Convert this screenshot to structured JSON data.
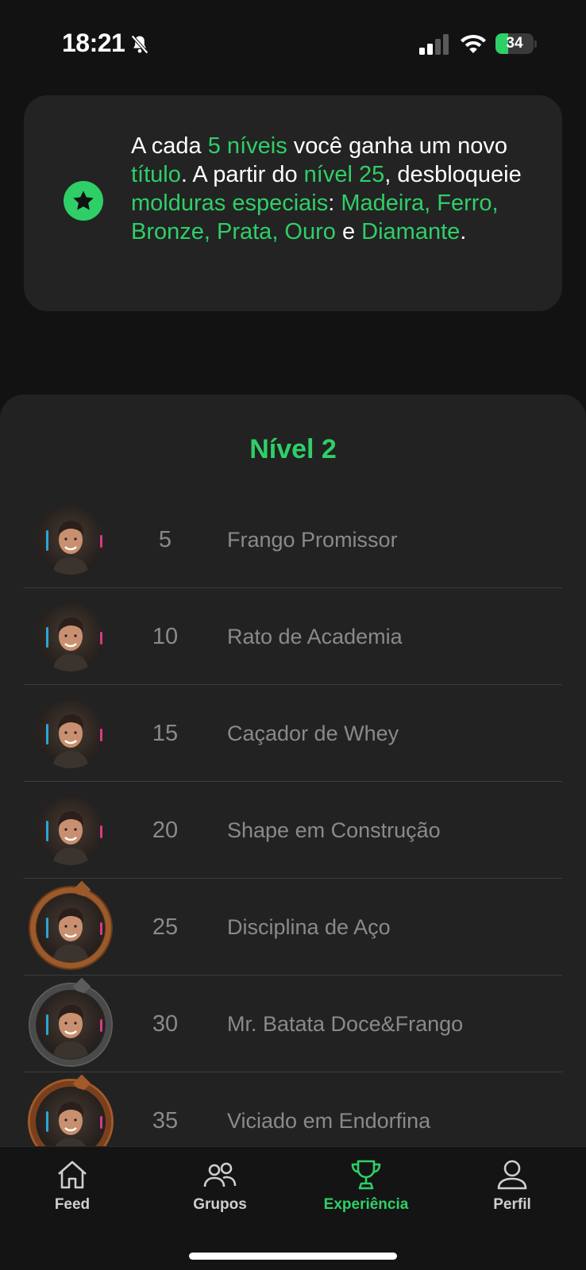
{
  "status_bar": {
    "time": "18:21",
    "battery_level": "34",
    "battery_fraction": 0.34,
    "icons": [
      "bell-slash-icon",
      "cellular-signal-icon",
      "wifi-icon",
      "battery-charging-icon"
    ]
  },
  "info_card": {
    "icon": "star-icon",
    "segments": [
      {
        "text": "A cada ",
        "hl": false
      },
      {
        "text": "5 níveis",
        "hl": true
      },
      {
        "text": " você ganha um novo ",
        "hl": false
      },
      {
        "text": "título",
        "hl": true
      },
      {
        "text": ". A partir do ",
        "hl": false
      },
      {
        "text": "nível 25",
        "hl": true
      },
      {
        "text": ", desbloqueie ",
        "hl": false
      },
      {
        "text": "molduras especiais",
        "hl": true
      },
      {
        "text": ": ",
        "hl": false
      },
      {
        "text": "Madeira, Ferro, Bronze, Prata, Ouro",
        "hl": true
      },
      {
        "text": " e ",
        "hl": false
      },
      {
        "text": "Diamante",
        "hl": true
      },
      {
        "text": ".",
        "hl": false
      }
    ]
  },
  "level_panel": {
    "title": "Nível 2",
    "rows": [
      {
        "level": "5",
        "title": "Frango Promissor",
        "frame": "none"
      },
      {
        "level": "10",
        "title": "Rato de Academia",
        "frame": "none"
      },
      {
        "level": "15",
        "title": "Caçador de Whey",
        "frame": "none"
      },
      {
        "level": "20",
        "title": "Shape em Construção",
        "frame": "none"
      },
      {
        "level": "25",
        "title": "Disciplina de Aço",
        "frame": "bronze"
      },
      {
        "level": "30",
        "title": "Mr. Batata Doce&Frango",
        "frame": "iron"
      },
      {
        "level": "35",
        "title": "Viciado em Endorfina",
        "frame": "thorn"
      }
    ]
  },
  "tab_bar": {
    "tabs": [
      {
        "label": "Feed",
        "icon": "home-icon",
        "active": false
      },
      {
        "label": "Grupos",
        "icon": "users-icon",
        "active": false
      },
      {
        "label": "Experiência",
        "icon": "trophy-icon",
        "active": true
      },
      {
        "label": "Perfil",
        "icon": "person-icon",
        "active": false
      }
    ]
  },
  "colors": {
    "accent": "#2fcf67",
    "background": "#121212",
    "card": "#232323",
    "muted_text": "#8a8a8a"
  }
}
